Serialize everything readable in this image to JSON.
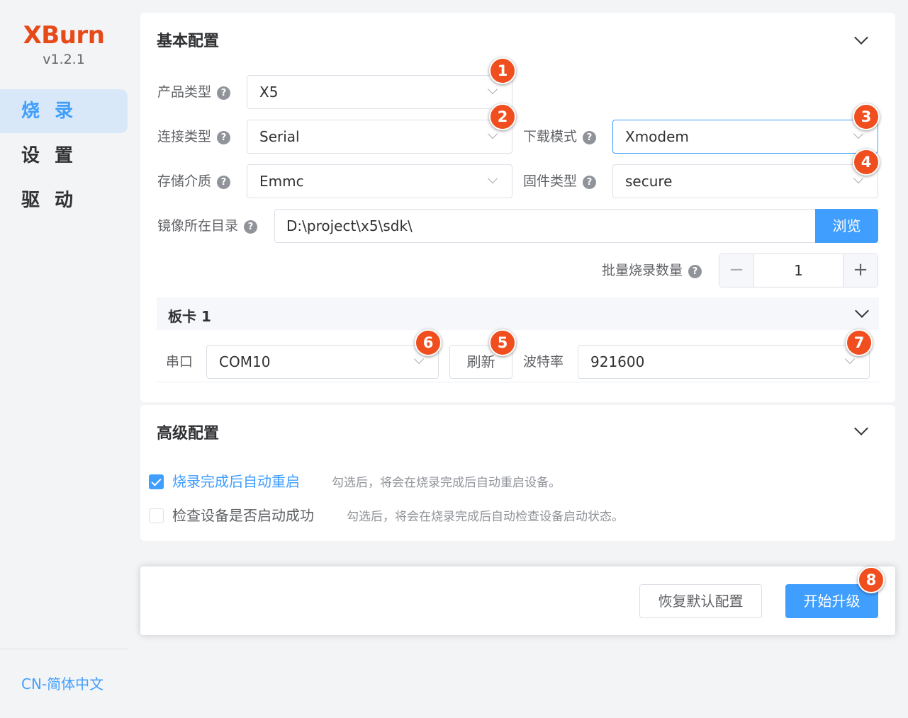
{
  "app": {
    "name": "XBurn",
    "version": "v1.2.1"
  },
  "sidebar": {
    "items": [
      {
        "label": "烧 录",
        "active": true
      },
      {
        "label": "设 置",
        "active": false
      },
      {
        "label": "驱 动",
        "active": false
      }
    ],
    "language": "CN-简体中文"
  },
  "basic": {
    "title": "基本配置",
    "product_type": {
      "label": "产品类型",
      "value": "X5"
    },
    "connection_type": {
      "label": "连接类型",
      "value": "Serial"
    },
    "download_mode": {
      "label": "下载模式",
      "value": "Xmodem"
    },
    "storage": {
      "label": "存储介质",
      "value": "Emmc"
    },
    "firmware_type": {
      "label": "固件类型",
      "value": "secure"
    },
    "image_dir": {
      "label": "镜像所在目录",
      "value": "D:\\project\\x5\\sdk\\"
    },
    "browse_label": "浏览",
    "batch": {
      "label": "批量烧录数量",
      "value": "1",
      "minus": "−",
      "plus": "+"
    },
    "board": {
      "title": "板卡 1",
      "port_label": "串口",
      "port_value": "COM10",
      "refresh_label": "刷新",
      "baud_label": "波特率",
      "baud_value": "921600"
    }
  },
  "advanced": {
    "title": "高级配置",
    "options": [
      {
        "label": "烧录完成后自动重启",
        "checked": true,
        "desc": "勾选后，将会在烧录完成后自动重启设备。"
      },
      {
        "label": "检查设备是否启动成功",
        "checked": false,
        "desc": "勾选后，将会在烧录完成后自动检查设备启动状态。"
      }
    ]
  },
  "footer": {
    "reset_label": "恢复默认配置",
    "start_label": "开始升级"
  },
  "help_glyph": "?",
  "badges": [
    "1",
    "2",
    "3",
    "4",
    "5",
    "6",
    "7",
    "8"
  ],
  "colors": {
    "accent": "#409eff",
    "brand": "#e64a19",
    "badge": "#f04e1e"
  }
}
